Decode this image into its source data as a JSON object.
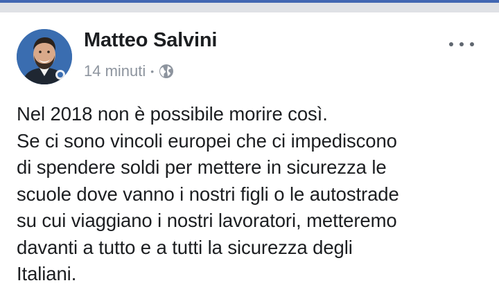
{
  "post": {
    "author": "Matteo Salvini",
    "timestamp": "14 minuti",
    "separator": "•",
    "audience_icon": "globe-icon",
    "more_icon": "more-options-icon",
    "body_lines": [
      "Nel 2018 non è possibile morire così.",
      "Se ci sono vincoli europei che ci impediscono",
      "di spendere soldi per mettere in sicurezza le",
      "scuole dove vanno i nostri figli o le autostrade",
      "su cui viaggiano i nostri lavoratori, metteremo",
      "davanti a tutto e a tutti la sicurezza degli",
      "Italiani."
    ]
  },
  "colors": {
    "accent": "#4267b2",
    "divider": "#dfe1e5",
    "text_primary": "#1c1e21",
    "text_meta": "#8d949e"
  }
}
